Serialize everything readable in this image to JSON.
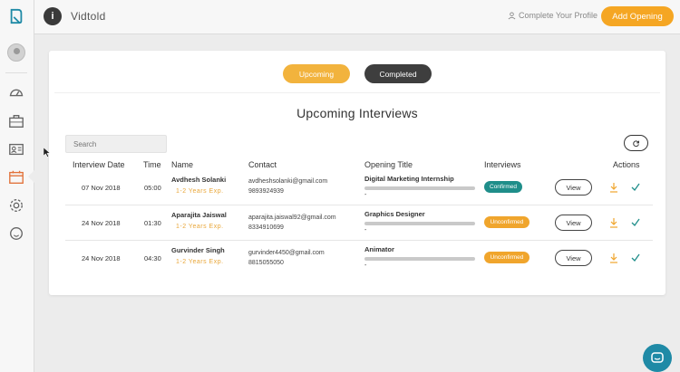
{
  "header": {
    "app_title": "Vidtold",
    "menu_glyph": "i",
    "profile_link": "Complete Your Profile",
    "add_opening": "Add Opening"
  },
  "sidebar": {
    "icons": [
      "logo-icon",
      "avatar",
      "dashboard-icon",
      "briefcase-icon",
      "id-card-icon",
      "calendar-icon",
      "settings-icon",
      "chat-icon"
    ],
    "active": "calendar-icon"
  },
  "tabs": {
    "upcoming": "Upcoming",
    "completed": "Completed",
    "active": "upcoming"
  },
  "title": "Upcoming Interviews",
  "search": {
    "placeholder": "Search"
  },
  "columns": {
    "date": "Interview Date",
    "time": "Time",
    "name": "Name",
    "contact": "Contact",
    "opening": "Opening Title",
    "interviews": "Interviews",
    "actions": "Actions"
  },
  "rows": [
    {
      "date": "07 Nov 2018",
      "time": "05:00",
      "name": "Avdhesh Solanki",
      "exp": "1-2 Years Exp.",
      "email": "avdheshsolanki@gmail.com",
      "phone": "9893924939",
      "opening": "Digital Marketing Internship",
      "opening_sub": "-",
      "status": "Confirmed",
      "view": "View"
    },
    {
      "date": "24 Nov 2018",
      "time": "01:30",
      "name": "Aparajita Jaiswal",
      "exp": "1-2 Years Exp.",
      "email": "aparajita.jaiswal92@gmail.com",
      "phone": "8334910699",
      "opening": "Graphics Designer",
      "opening_sub": "-",
      "status": "Unconfirmed",
      "view": "View"
    },
    {
      "date": "24 Nov 2018",
      "time": "04:30",
      "name": "Gurvinder Singh",
      "exp": "1-2 Years Exp.",
      "email": "gurvinder4450@gmail.com",
      "phone": "8815055050",
      "opening": "Animator",
      "opening_sub": "-",
      "status": "Unconfirmed",
      "view": "View"
    }
  ],
  "colors": {
    "accent": "#f5a623",
    "confirmed": "#1f8e8a",
    "unconfirmed": "#f0a52c",
    "dark": "#3e3e3e",
    "chat": "#1f8aa6"
  }
}
